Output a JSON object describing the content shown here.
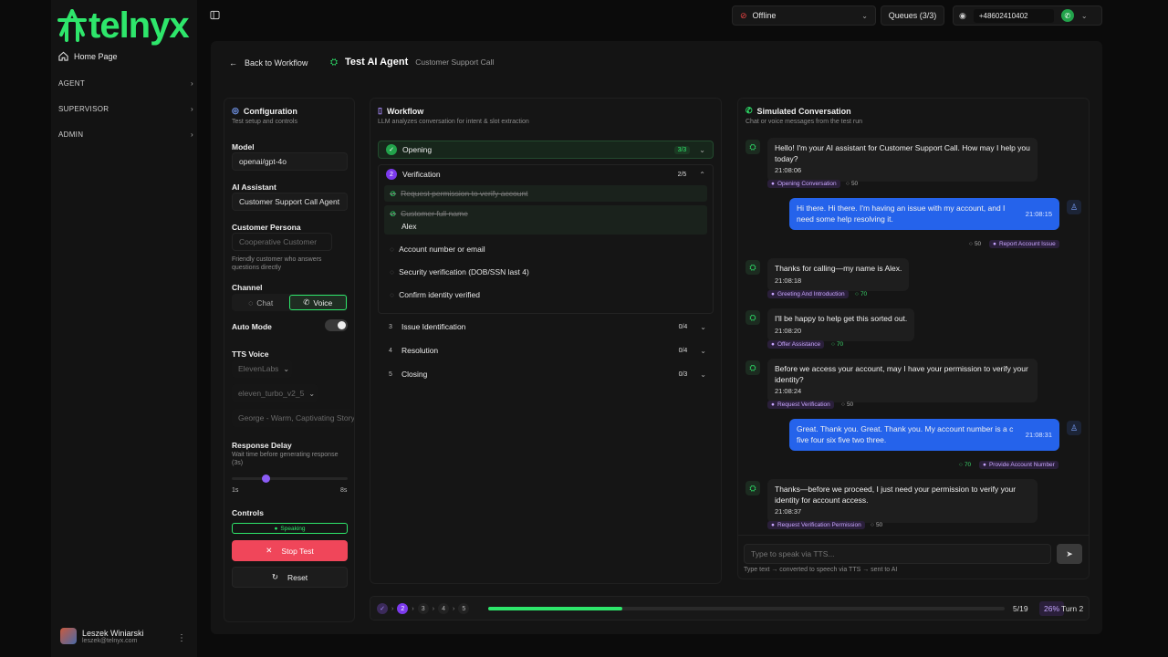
{
  "sidebar": {
    "logo": "telnyx",
    "home": "Home Page",
    "sections": [
      "AGENT",
      "SUPERVISOR",
      "ADMIN"
    ],
    "user": {
      "name": "Leszek Winiarski",
      "email": "leszek@telnyx.com"
    }
  },
  "topbar": {
    "status": "Offline",
    "queues": "Queues (3/3)",
    "phone": "+48602410402"
  },
  "header": {
    "back": "Back to Workflow",
    "title": "Test AI Agent",
    "subtitle": "Customer Support Call"
  },
  "config": {
    "title": "Configuration",
    "subtitle": "Test setup and controls",
    "model_label": "Model",
    "model": "openai/gpt-4o",
    "assistant_label": "AI Assistant",
    "assistant": "Customer Support Call Agent",
    "persona_label": "Customer Persona",
    "persona": "Cooperative Customer",
    "persona_desc": "Friendly customer who answers questions directly",
    "channel_label": "Channel",
    "channel_chat": "Chat",
    "channel_voice": "Voice",
    "auto_mode": "Auto Mode",
    "tts_label": "TTS Voice",
    "tts_provider": "ElevenLabs",
    "tts_model": "eleven_turbo_v2_5",
    "tts_voice": "George - Warm, Captivating Storyteller",
    "delay_label": "Response Delay",
    "delay_desc": "Wait time before generating response (3s)",
    "delay_min": "1s",
    "delay_max": "8s",
    "delay_value_fraction": 0.29,
    "controls_label": "Controls",
    "speaking": "Speaking",
    "stop": "Stop Test",
    "reset": "Reset"
  },
  "workflow": {
    "title": "Workflow",
    "subtitle": "LLM analyzes conversation for intent & slot extraction",
    "stages": [
      {
        "num": "1",
        "name": "Opening",
        "count": "3/3"
      },
      {
        "num": "2",
        "name": "Verification",
        "count": "2/5"
      },
      {
        "num": "3",
        "name": "Issue Identification",
        "count": "0/4"
      },
      {
        "num": "4",
        "name": "Resolution",
        "count": "0/4"
      },
      {
        "num": "5",
        "name": "Closing",
        "count": "0/3"
      }
    ],
    "slots": [
      {
        "label": "Request permission to verify account",
        "value": ""
      },
      {
        "label": "Customer full name",
        "value": "Alex"
      },
      {
        "label": "Account number or email",
        "value": ""
      },
      {
        "label": "Security verification (DOB/SSN last 4)",
        "value": ""
      },
      {
        "label": "Confirm identity verified",
        "value": ""
      }
    ]
  },
  "conversation": {
    "title": "Simulated Conversation",
    "subtitle": "Chat or voice messages from the test run",
    "messages": [
      {
        "from": "ai",
        "text": "Hello! I'm your AI assistant for Customer Support Call. How may I help you today?",
        "time": "21:08:06",
        "tag": "Opening Conversation",
        "conf": "50"
      },
      {
        "from": "user",
        "text": "Hi there. Hi there. I'm having an issue with my account, and I need some help resolving it.",
        "time": "21:08:15",
        "tag": "Report Account Issue",
        "conf": "50"
      },
      {
        "from": "ai",
        "text": "Thanks for calling—my name is Alex.",
        "time": "21:08:18",
        "tag": "Greeting And Introduction",
        "conf": "70"
      },
      {
        "from": "ai",
        "text": "I'll be happy to help get this sorted out.",
        "time": "21:08:20",
        "tag": "Offer Assistance",
        "conf": "70"
      },
      {
        "from": "ai",
        "text": "Before we access your account, may I have your permission to verify your identity?",
        "time": "21:08:24",
        "tag": "Request Verification",
        "conf": "50"
      },
      {
        "from": "user",
        "text": "Great. Thank you. Great. Thank you. My account number is a c five four six five two three.",
        "time": "21:08:31",
        "tag": "Provide Account Number",
        "conf": "70"
      },
      {
        "from": "ai",
        "text": "Thanks—before we proceed, I just need your permission to verify your identity for account access.",
        "time": "21:08:37",
        "tag": "Request Verification Permission",
        "conf": "50"
      }
    ],
    "input_placeholder": "Type to speak via TTS...",
    "hint": "Type text → converted to speech via TTS → sent to AI"
  },
  "progress": {
    "steps": [
      "2",
      "3",
      "4",
      "5"
    ],
    "count": "5/19",
    "percent": "26%",
    "fraction": 0.26,
    "turn": "Turn 2"
  },
  "colors": {
    "brand": "#2ee66b",
    "accent": "#8b5cf6",
    "user_bubble": "#2563eb",
    "danger": "#f0465a"
  }
}
